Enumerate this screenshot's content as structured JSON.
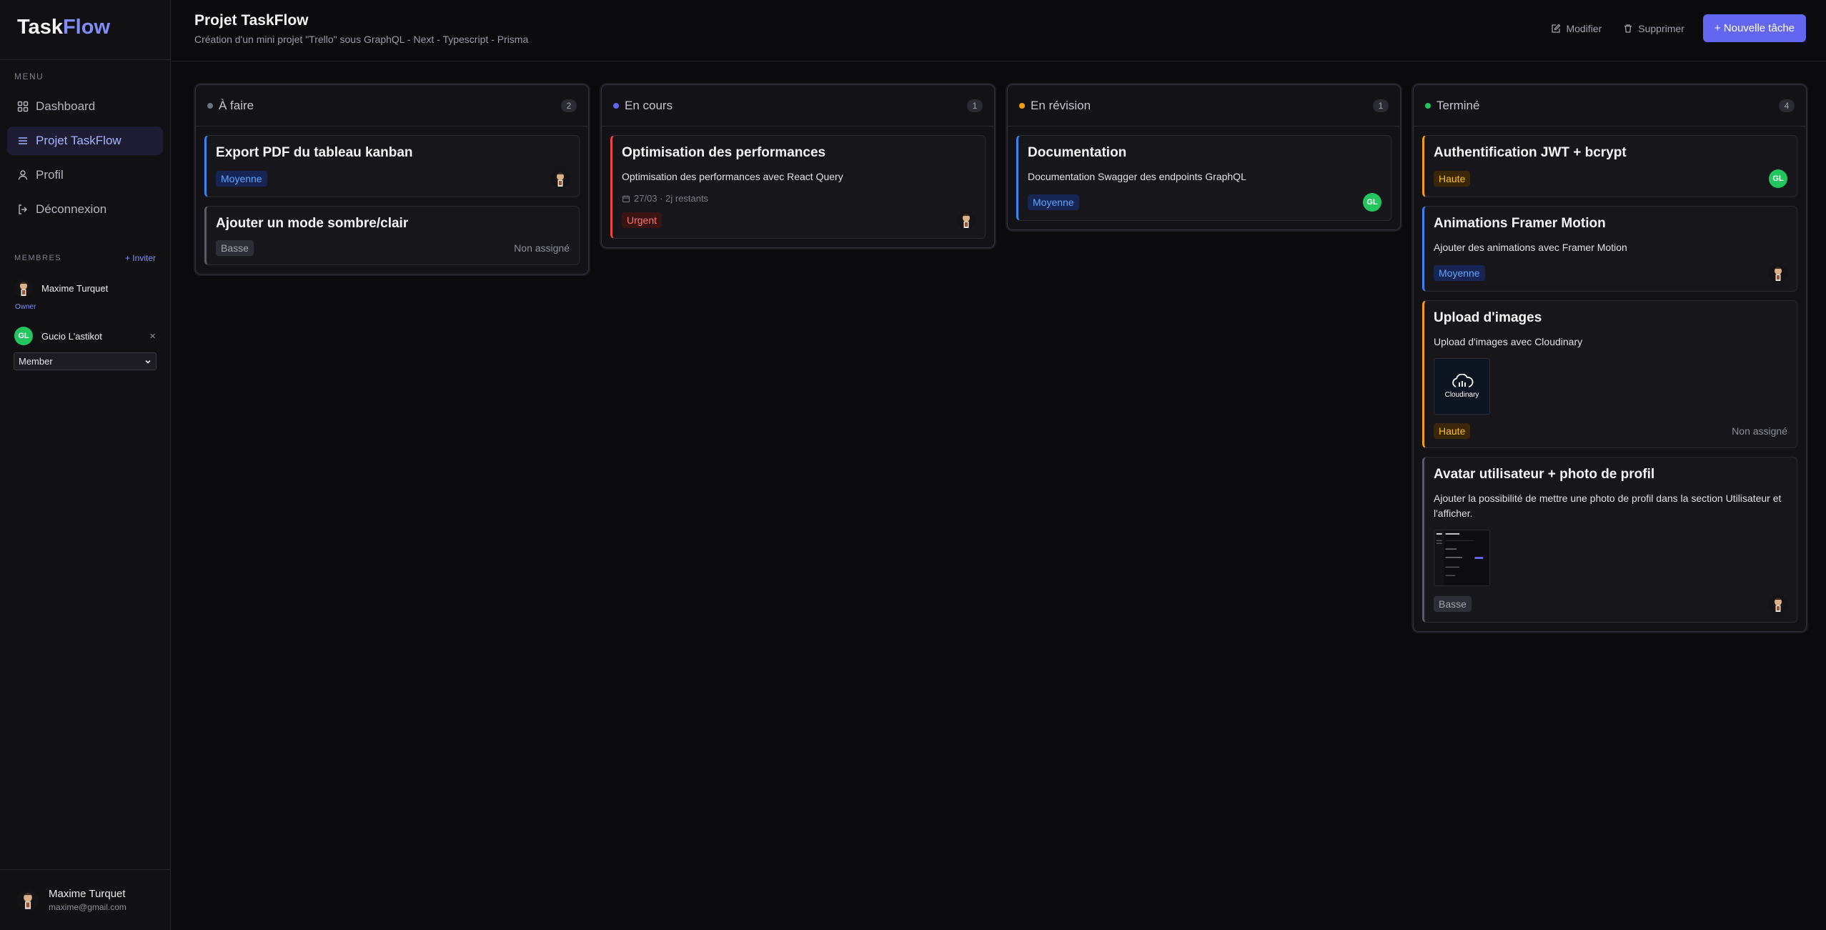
{
  "sidebar": {
    "logo_part1": "Task",
    "logo_part2": "Flow",
    "menu_label": "MENU",
    "nav": [
      {
        "label": "Dashboard",
        "icon": "grid-icon"
      },
      {
        "label": "Projet TaskFlow",
        "icon": "list-icon",
        "active": true
      },
      {
        "label": "Profil",
        "icon": "user-icon"
      },
      {
        "label": "Déconnexion",
        "icon": "logout-icon"
      }
    ],
    "members_label": "MEMBRES",
    "invite_label": "+ Inviter",
    "members": [
      {
        "name": "Maxime Turquet",
        "role_tag": "Owner"
      },
      {
        "name": "Gucio L'astikot",
        "initials": "GL",
        "role": "Member"
      }
    ],
    "user": {
      "name": "Maxime Turquet",
      "email": "maxime@gmail.com"
    }
  },
  "header": {
    "title": "Projet TaskFlow",
    "subtitle": "Création d'un mini projet \"Trello\" sous GraphQL - Next - Typescript - Prisma",
    "edit_label": "Modifier",
    "delete_label": "Supprimer",
    "new_task_label": "+ Nouvelle tâche"
  },
  "colors": {
    "accent": "#6366f1",
    "todo": "#6b7280",
    "in_progress": "#6366f1",
    "review": "#f59e0b",
    "done": "#22c55e"
  },
  "columns": [
    {
      "title": "À faire",
      "count": "2",
      "cards": [
        {
          "title": "Export PDF du tableau kanban",
          "priority": "Moyenne"
        },
        {
          "title": "Ajouter un mode sombre/clair",
          "priority": "Basse",
          "assignee": "Non assigné"
        }
      ]
    },
    {
      "title": "En cours",
      "count": "1",
      "cards": [
        {
          "title": "Optimisation des performances",
          "description": "Optimisation des performances avec React Query",
          "due": "27/03 · 2j restants",
          "priority": "Urgent"
        }
      ]
    },
    {
      "title": "En révision",
      "count": "1",
      "cards": [
        {
          "title": "Documentation",
          "description": "Documentation Swagger des endpoints GraphQL",
          "priority": "Moyenne",
          "assignee_initials": "GL"
        }
      ]
    },
    {
      "title": "Terminé",
      "count": "4",
      "cards": [
        {
          "title": "Authentification JWT + bcrypt",
          "priority": "Haute",
          "assignee_initials": "GL"
        },
        {
          "title": "Animations Framer Motion",
          "description": "Ajouter des animations avec Framer Motion",
          "priority": "Moyenne"
        },
        {
          "title": "Upload d'images",
          "description": "Upload d'images avec Cloudinary",
          "image_label": "Cloudinary",
          "priority": "Haute",
          "assignee": "Non assigné"
        },
        {
          "title": "Avatar utilisateur + photo de profil",
          "description": "Ajouter la possibilité de mettre une photo de profil dans la section Utilisateur et l'afficher.",
          "priority": "Basse"
        }
      ]
    }
  ]
}
